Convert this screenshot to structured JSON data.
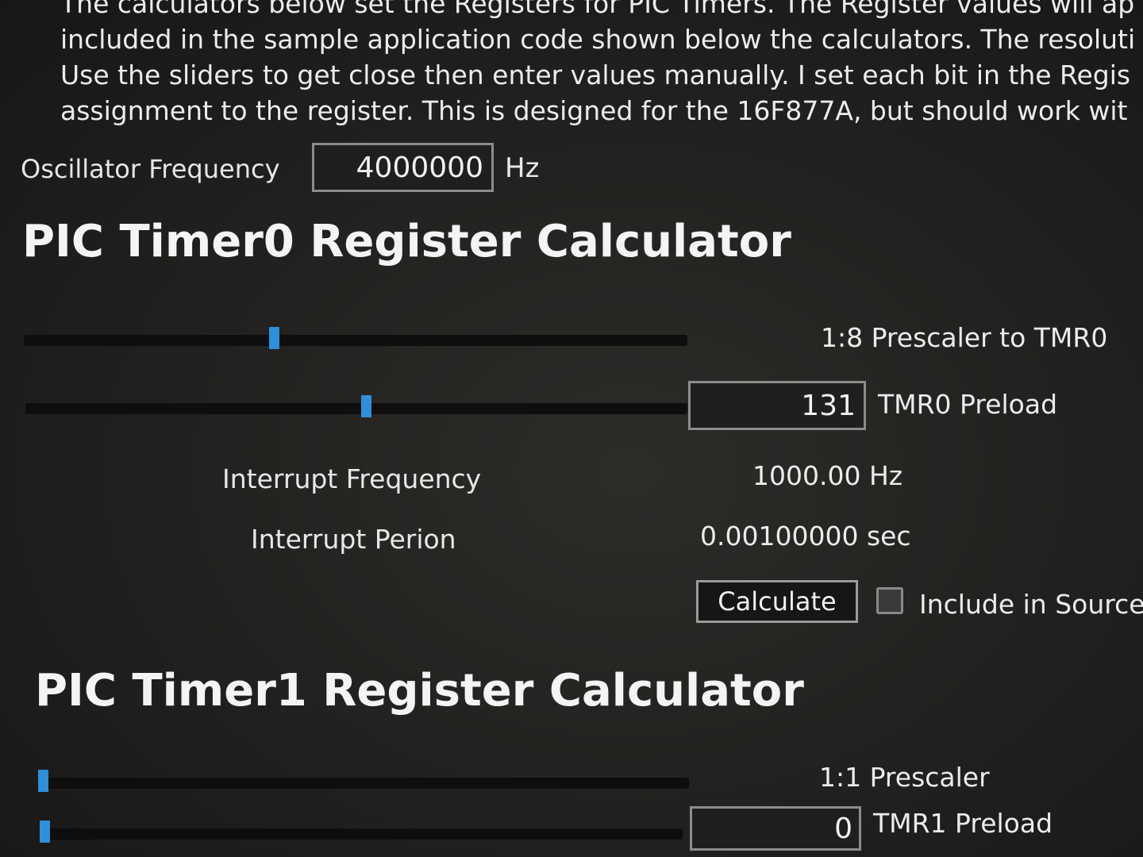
{
  "intro": {
    "line1": "The calculators below set the Registers for PIC Timers. The Register values will ap",
    "line2": "included in the sample application code shown below the calculators. The resoluti",
    "line3": "Use the sliders to get close then enter values manually. I set each bit in the Regis",
    "line4": "assignment to the register. This is designed for the 16F877A, but should work wit"
  },
  "oscillator": {
    "label": "Oscillator Frequency",
    "value": "4000000",
    "unit": "Hz"
  },
  "timer0": {
    "title": "PIC Timer0 Register Calculator",
    "prescaler_slider": {
      "position": 0.375
    },
    "prescaler_label": "1:8 Prescaler to TMR0",
    "preload_slider": {
      "position": 0.515
    },
    "preload_value": "131",
    "preload_label": "TMR0 Preload",
    "interrupt_frequency_label": "Interrupt Frequency",
    "interrupt_frequency_value": "1000.00 Hz",
    "interrupt_period_label": "Interrupt Perion",
    "interrupt_period_value": "0.00100000 sec",
    "calculate_label": "Calculate",
    "include_in_source_label": "Include in Source",
    "include_in_source_checked": false
  },
  "timer1": {
    "title": "PIC Timer1 Register Calculator",
    "prescaler_slider": {
      "position": 0.0
    },
    "prescaler_label": "1:1 Prescaler",
    "preload_slider": {
      "position": 0.0
    },
    "preload_value": "0",
    "preload_label": "TMR1 Preload"
  },
  "colors": {
    "background": "#1c1b19",
    "text": "#ececec",
    "slider_thumb": "#2f8fd8",
    "slider_track": "#0e0e0e",
    "input_border": "#8c8c8c"
  }
}
